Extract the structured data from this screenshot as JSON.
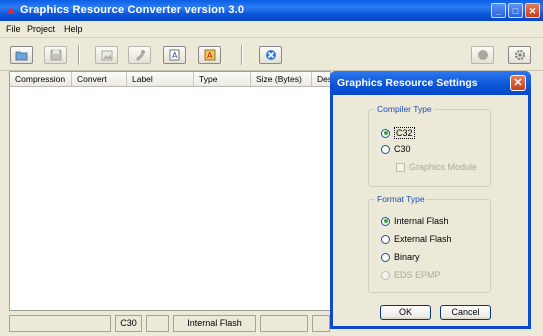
{
  "window": {
    "title": "Graphics Resource Converter version 3.0"
  },
  "menu": [
    "File",
    "Project",
    "Help"
  ],
  "toolbar": {
    "icons": [
      "open-folder-icon",
      "save-icon",
      "add-image-icon",
      "add-tool-icon",
      "add-text-icon",
      "add-font-icon",
      "delete-icon",
      "circle-icon",
      "settings-icon"
    ]
  },
  "grid": {
    "columns": [
      "Compression",
      "Convert",
      "Label",
      "Type",
      "Size (Bytes)",
      "Desc"
    ]
  },
  "status": {
    "compiler": "C30",
    "memory": "Internal Flash"
  },
  "dialog": {
    "title": "Graphics Resource Settings",
    "compiler_group": "Compiler Type",
    "compiler_options": [
      {
        "label": "C32",
        "checked": true,
        "disabled": false
      },
      {
        "label": "C30",
        "checked": false,
        "disabled": false
      }
    ],
    "graphics_module": "Graphics Module",
    "format_group": "Format Type",
    "format_options": [
      {
        "label": "Internal Flash",
        "checked": true,
        "disabled": false
      },
      {
        "label": "External Flash",
        "checked": false,
        "disabled": false
      },
      {
        "label": "Binary",
        "checked": false,
        "disabled": false
      },
      {
        "label": "EDS EPMP",
        "checked": false,
        "disabled": true
      }
    ],
    "ok": "OK",
    "cancel": "Cancel"
  }
}
